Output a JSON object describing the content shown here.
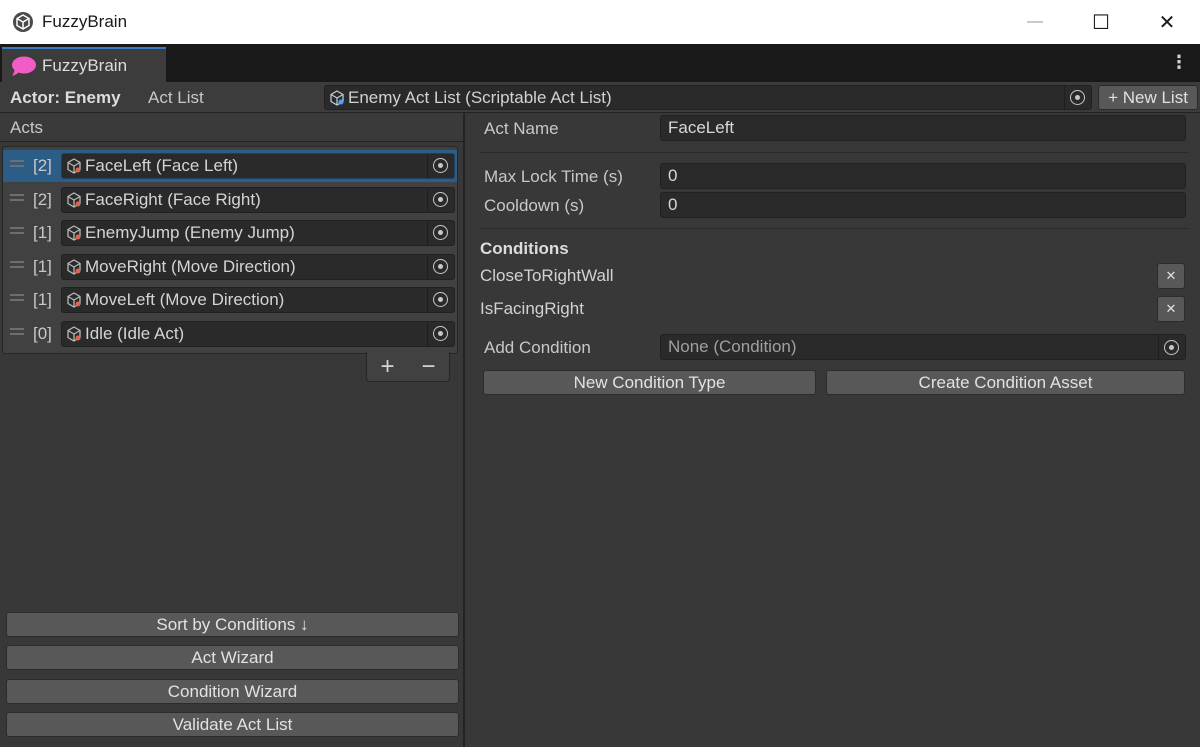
{
  "window": {
    "title": "FuzzyBrain",
    "icon": "unity-cube-icon",
    "controls": {
      "minimize": "—",
      "maximize": "☐",
      "close": "✕"
    }
  },
  "tab": {
    "label": "FuzzyBrain",
    "icon": "brain-icon",
    "icon_color": "#f25cc7",
    "menu_icon": "⋮"
  },
  "toolbar": {
    "actor_label": "Actor: Enemy",
    "act_list_label": "Act List",
    "act_list_value": "Enemy Act List (Scriptable Act List)",
    "new_list_button": "+ New List"
  },
  "acts_panel": {
    "header": "Acts",
    "items": [
      {
        "priority": "[2]",
        "label": "FaceLeft (Face Left)",
        "selected": true
      },
      {
        "priority": "[2]",
        "label": "FaceRight (Face Right)",
        "selected": false
      },
      {
        "priority": "[1]",
        "label": "EnemyJump (Enemy Jump)",
        "selected": false
      },
      {
        "priority": "[1]",
        "label": "MoveRight (Move Direction)",
        "selected": false
      },
      {
        "priority": "[1]",
        "label": "MoveLeft (Move Direction)",
        "selected": false
      },
      {
        "priority": "[0]",
        "label": "Idle (Idle Act)",
        "selected": false
      }
    ],
    "add_button": "+",
    "remove_button": "−",
    "buttons": {
      "sort": "Sort by Conditions ↓",
      "act_wizard": "Act Wizard",
      "condition_wizard": "Condition Wizard",
      "validate": "Validate Act List"
    }
  },
  "detail_panel": {
    "act_name_label": "Act Name",
    "act_name_value": "FaceLeft",
    "max_lock_label": "Max Lock Time (s)",
    "max_lock_value": "0",
    "cooldown_label": "Cooldown (s)",
    "cooldown_value": "0",
    "conditions_title": "Conditions",
    "conditions": [
      "CloseToRightWall",
      "IsFacingRight"
    ],
    "remove_glyph": "✕",
    "add_condition_label": "Add Condition",
    "add_condition_value": "None (Condition)",
    "new_condition_type_button": "New Condition Type",
    "create_condition_asset_button": "Create Condition Asset"
  },
  "colors": {
    "selection": "#2c5d87",
    "accent": "#3a79bb",
    "panel": "#383838",
    "field": "#2a2a2a"
  }
}
